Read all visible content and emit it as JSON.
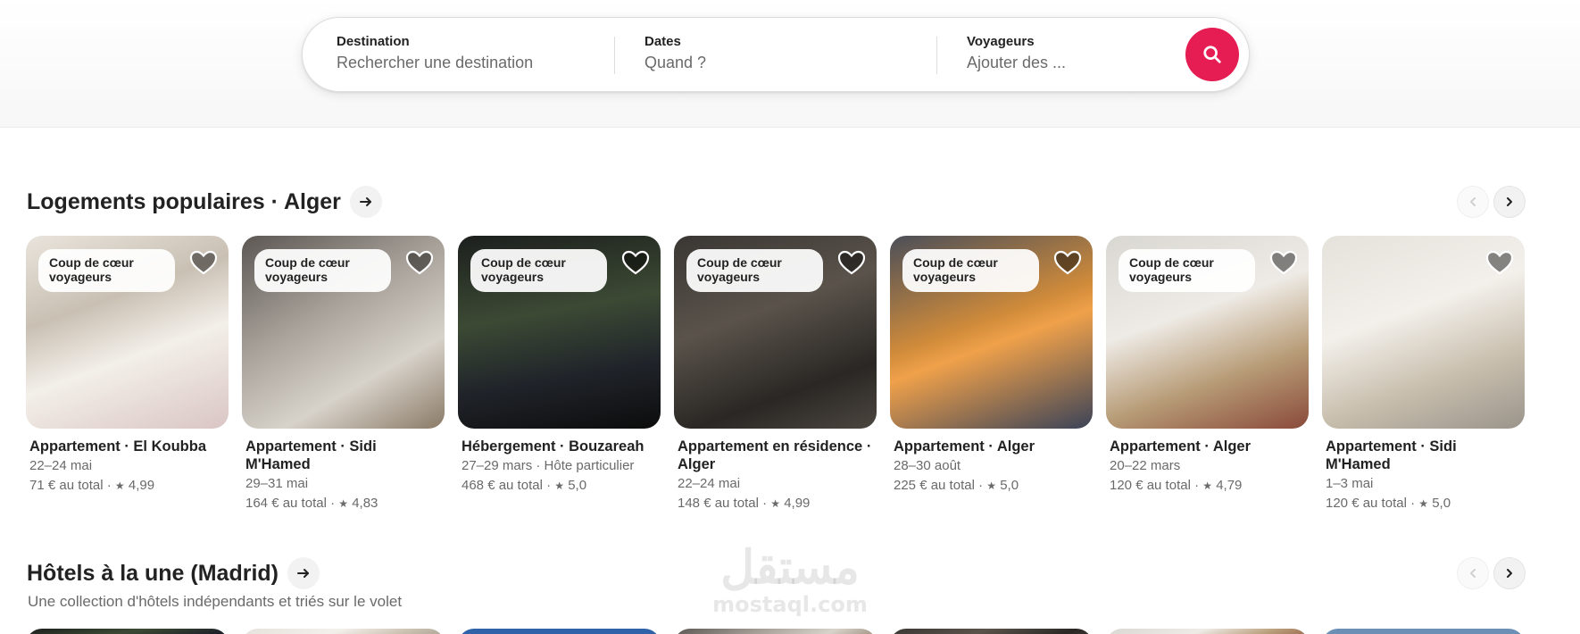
{
  "search": {
    "destination": {
      "label": "Destination",
      "placeholder": "Rechercher une destination"
    },
    "dates": {
      "label": "Dates",
      "placeholder": "Quand ?"
    },
    "guests": {
      "label": "Voyageurs",
      "placeholder": "Ajouter des ..."
    },
    "button_icon": "search-icon",
    "accent_color": "#e51d53"
  },
  "sections": [
    {
      "title": "Logements populaires · Alger",
      "cards": [
        {
          "badge": "Coup de cœur voyageurs",
          "title": "Appartement · El Koubba",
          "dates": "22–24 mai",
          "price": "71 € au total",
          "rating": "4,99"
        },
        {
          "badge": "Coup de cœur voyageurs",
          "title": "Appartement · Sidi M'Hamed",
          "dates": "29–31 mai",
          "price": "164 € au total",
          "rating": "4,83"
        },
        {
          "badge": "Coup de cœur voyageurs",
          "title": "Hébergement · Bouzareah",
          "dates": "27–29 mars · Hôte particulier",
          "price": "468 € au total",
          "rating": "5,0"
        },
        {
          "badge": "Coup de cœur voyageurs",
          "title": "Appartement en résidence · Alger",
          "dates": "22–24 mai",
          "price": "148 € au total",
          "rating": "4,99"
        },
        {
          "badge": "Coup de cœur voyageurs",
          "title": "Appartement · Alger",
          "dates": "28–30 août",
          "price": "225 € au total",
          "rating": "5,0"
        },
        {
          "badge": "Coup de cœur voyageurs",
          "title": "Appartement · Alger",
          "dates": "20–22 mars",
          "price": "120 € au total",
          "rating": "4,79"
        },
        {
          "badge": "",
          "title": "Appartement · Sidi M'Hamed",
          "dates": "1–3 mai",
          "price": "120 € au total",
          "rating": "5,0"
        }
      ]
    },
    {
      "title": "Hôtels à la une (Madrid)",
      "subtitle": "Une collection d'hôtels indépendants et triés sur le volet"
    }
  ],
  "watermark": {
    "arabic": "مستقل",
    "latin": "mostaql.com"
  }
}
